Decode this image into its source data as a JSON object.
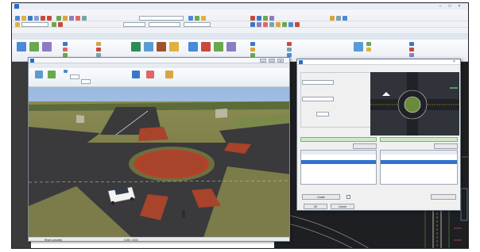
{
  "colors": {
    "accent": "#2a6fc9",
    "selection": "#2f72d0",
    "green_bar": "#cfe9c8",
    "road": "#3a3a3c",
    "grass": "#8a8a52",
    "roundabout_center": "#b5402a",
    "sky": "#b9d0ec"
  },
  "icons": [
    "app-icon",
    "minimize-icon",
    "maximize-icon",
    "close-icon",
    "pushpin-icon"
  ],
  "dialog": {
    "create_button": "Create",
    "ok_button": "OK",
    "cancel_button": "Cancel"
  },
  "view_window": {
    "status_left": "Reset complete",
    "status_mid": "0.000, 0.000"
  }
}
